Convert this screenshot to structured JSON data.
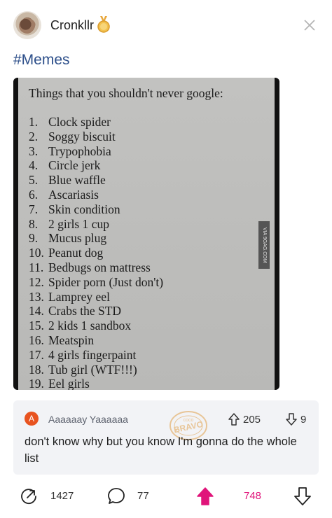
{
  "post": {
    "username": "Cronkllr",
    "tag": "#Memes",
    "image": {
      "title": "Things that you shouldn't never google:",
      "watermark": "VIA 9GAG.COM",
      "items": [
        {
          "num": "1.",
          "text": "Clock spider"
        },
        {
          "num": "2.",
          "text": "Soggy biscuit"
        },
        {
          "num": "3.",
          "text": "Trypophobia"
        },
        {
          "num": "4.",
          "text": "Circle jerk"
        },
        {
          "num": "5.",
          "text": "Blue waffle"
        },
        {
          "num": "6.",
          "text": "Ascariasis"
        },
        {
          "num": "7.",
          "text": "Skin condition"
        },
        {
          "num": "8.",
          "text": "2 girls 1 cup"
        },
        {
          "num": "9.",
          "text": "Mucus plug"
        },
        {
          "num": "10.",
          "text": "Peanut dog"
        },
        {
          "num": "11.",
          "text": "Bedbugs on mattress"
        },
        {
          "num": "12.",
          "text": "Spider porn (Just don't)"
        },
        {
          "num": "13.",
          "text": "Lamprey eel"
        },
        {
          "num": "14.",
          "text": "Crabs the STD"
        },
        {
          "num": "15.",
          "text": "2 kids 1 sandbox"
        },
        {
          "num": "16.",
          "text": "Meatspin"
        },
        {
          "num": "17.",
          "text": "4 girls fingerpaint"
        },
        {
          "num": "18.",
          "text": "Tub girl (WTF!!!)"
        },
        {
          "num": "19.",
          "text": "Eel girls"
        }
      ]
    }
  },
  "top_comment": {
    "avatar_letter": "A",
    "username": "Aaaaaay Yaaaaaa",
    "upvotes": "205",
    "downvotes": "9",
    "text": "don't know why but you know I'm gonna do the whole list",
    "stamp": {
      "line1": "coco",
      "line2": "BRAVO"
    }
  },
  "actions": {
    "shares": "1427",
    "comments": "77",
    "upvotes": "748"
  },
  "colors": {
    "tag": "#2d4f8a",
    "accent_upvote": "#e0147a",
    "comment_bg": "#f2f3f6",
    "comment_avatar": "#e8531f"
  },
  "icons": {
    "medal": "medal-icon",
    "close": "close-icon",
    "share": "share-icon",
    "comment": "comment-icon",
    "upvote": "upvote-icon",
    "downvote": "downvote-icon"
  }
}
